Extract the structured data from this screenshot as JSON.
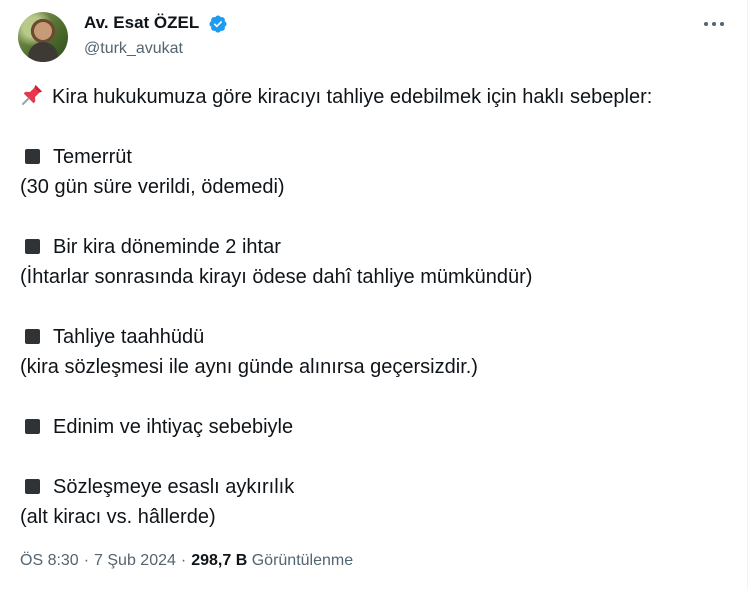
{
  "author": {
    "name": "Av. Esat ÖZEL",
    "handle": "@turk_avukat",
    "verified": true,
    "verified_color": "#1d9bf0"
  },
  "tweet": {
    "intro": "Kira hukukumuza göre kiracıyı tahliye edebilmek için haklı sebepler:",
    "intro_icon": "pushpin-icon",
    "items": [
      {
        "title": "Temerrüt",
        "note": "(30 gün süre verildi, ödemedi)"
      },
      {
        "title": "Bir kira döneminde 2 ihtar",
        "note": "(İhtarlar sonrasında kirayı ödese dahî tahliye mümkündür)"
      },
      {
        "title": "Tahliye taahhüdü",
        "note": "(kira sözleşmesi ile aynı günde alınırsa geçersizdir.)"
      },
      {
        "title": "Edinim ve ihtiyaç sebebiyle",
        "note": ""
      },
      {
        "title": "Sözleşmeye esaslı aykırılık",
        "note": "(alt kiracı vs. hâllerde)"
      }
    ]
  },
  "meta": {
    "time": "ÖS 8:30",
    "sep": "·",
    "date": "7 Şub 2024",
    "views_count": "298,7 B",
    "views_label": "Görüntülenme"
  }
}
